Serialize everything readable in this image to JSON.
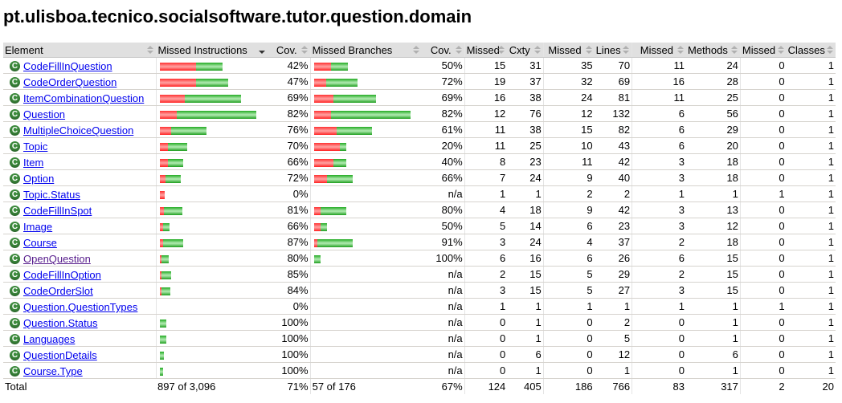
{
  "title": "pt.ulisboa.tecnico.socialsoftware.tutor.question.domain",
  "columns": [
    "Element",
    "Missed Instructions",
    "Cov.",
    "Missed Branches",
    "Cov.",
    "Missed",
    "Cxty",
    "Missed",
    "Lines",
    "Missed",
    "Methods",
    "Missed",
    "Classes"
  ],
  "sorted_column": "Missed Instructions",
  "colors": {
    "missed": "#ff3030",
    "covered": "#22aa22",
    "header_bg": "#e0e0e0",
    "link": "#0000ee",
    "visited_link": "#551a8b",
    "class_icon": "#3c8a3c"
  },
  "rows": [
    {
      "name": "CodeFillInQuestion",
      "visited": false,
      "instr_missed": 224,
      "instr_covered": 166,
      "instr_cov": "42%",
      "br_missed": 16,
      "br_covered": 16,
      "br_cov": "50%",
      "cxty_missed": "15",
      "cxty": "31",
      "lines_missed": "35",
      "lines": "70",
      "methods_missed": "11",
      "methods": "24",
      "classes_missed": "0",
      "classes": "1"
    },
    {
      "name": "CodeOrderQuestion",
      "visited": false,
      "instr_missed": 224,
      "instr_covered": 202,
      "instr_cov": "47%",
      "br_missed": 11,
      "br_covered": 29,
      "br_cov": "72%",
      "cxty_missed": "19",
      "cxty": "37",
      "lines_missed": "32",
      "lines": "69",
      "methods_missed": "16",
      "methods": "28",
      "classes_missed": "0",
      "classes": "1"
    },
    {
      "name": "ItemCombinationQuestion",
      "visited": false,
      "instr_missed": 156,
      "instr_covered": 352,
      "instr_cov": "69%",
      "br_missed": 18,
      "br_covered": 40,
      "br_cov": "69%",
      "cxty_missed": "16",
      "cxty": "38",
      "lines_missed": "24",
      "lines": "81",
      "methods_missed": "11",
      "methods": "25",
      "classes_missed": "0",
      "classes": "1"
    },
    {
      "name": "Question",
      "visited": false,
      "instr_missed": 106,
      "instr_covered": 494,
      "instr_cov": "82%",
      "br_missed": 16,
      "br_covered": 74,
      "br_cov": "82%",
      "cxty_missed": "12",
      "cxty": "76",
      "lines_missed": "12",
      "lines": "132",
      "methods_missed": "6",
      "methods": "56",
      "classes_missed": "0",
      "classes": "1"
    },
    {
      "name": "MultipleChoiceQuestion",
      "visited": false,
      "instr_missed": 70,
      "instr_covered": 218,
      "instr_cov": "76%",
      "br_missed": 21,
      "br_covered": 33,
      "br_cov": "61%",
      "cxty_missed": "11",
      "cxty": "38",
      "lines_missed": "15",
      "lines": "82",
      "methods_missed": "6",
      "methods": "29",
      "classes_missed": "0",
      "classes": "1"
    },
    {
      "name": "Topic",
      "visited": false,
      "instr_missed": 52,
      "instr_covered": 122,
      "instr_cov": "70%",
      "br_missed": 24,
      "br_covered": 6,
      "br_cov": "20%",
      "cxty_missed": "11",
      "cxty": "25",
      "lines_missed": "10",
      "lines": "43",
      "methods_missed": "6",
      "methods": "20",
      "classes_missed": "0",
      "classes": "1"
    },
    {
      "name": "Item",
      "visited": false,
      "instr_missed": 50,
      "instr_covered": 96,
      "instr_cov": "66%",
      "br_missed": 18,
      "br_covered": 12,
      "br_cov": "40%",
      "cxty_missed": "8",
      "cxty": "23",
      "lines_missed": "11",
      "lines": "42",
      "methods_missed": "3",
      "methods": "18",
      "classes_missed": "0",
      "classes": "1"
    },
    {
      "name": "Option",
      "visited": false,
      "instr_missed": 36,
      "instr_covered": 96,
      "instr_cov": "72%",
      "br_missed": 12,
      "br_covered": 24,
      "br_cov": "66%",
      "cxty_missed": "7",
      "cxty": "24",
      "lines_missed": "9",
      "lines": "40",
      "methods_missed": "3",
      "methods": "18",
      "classes_missed": "0",
      "classes": "1"
    },
    {
      "name": "Topic.Status",
      "visited": false,
      "instr_missed": 30,
      "instr_covered": 0,
      "instr_cov": "0%",
      "br_missed": 0,
      "br_covered": 0,
      "br_cov": "n/a",
      "cxty_missed": "1",
      "cxty": "1",
      "lines_missed": "2",
      "lines": "2",
      "methods_missed": "1",
      "methods": "1",
      "classes_missed": "1",
      "classes": "1"
    },
    {
      "name": "CodeFillInSpot",
      "visited": false,
      "instr_missed": 26,
      "instr_covered": 114,
      "instr_cov": "81%",
      "br_missed": 6,
      "br_covered": 24,
      "br_cov": "80%",
      "cxty_missed": "4",
      "cxty": "18",
      "lines_missed": "9",
      "lines": "42",
      "methods_missed": "3",
      "methods": "13",
      "classes_missed": "0",
      "classes": "1"
    },
    {
      "name": "Image",
      "visited": false,
      "instr_missed": 20,
      "instr_covered": 40,
      "instr_cov": "66%",
      "br_missed": 6,
      "br_covered": 6,
      "br_cov": "50%",
      "cxty_missed": "5",
      "cxty": "14",
      "lines_missed": "6",
      "lines": "23",
      "methods_missed": "3",
      "methods": "12",
      "classes_missed": "0",
      "classes": "1"
    },
    {
      "name": "Course",
      "visited": false,
      "instr_missed": 18,
      "instr_covered": 126,
      "instr_cov": "87%",
      "br_missed": 3,
      "br_covered": 33,
      "br_cov": "91%",
      "cxty_missed": "3",
      "cxty": "24",
      "lines_missed": "4",
      "lines": "37",
      "methods_missed": "2",
      "methods": "18",
      "classes_missed": "0",
      "classes": "1"
    },
    {
      "name": "OpenQuestion",
      "visited": true,
      "instr_missed": 12,
      "instr_covered": 46,
      "instr_cov": "80%",
      "br_missed": 0,
      "br_covered": 6,
      "br_cov": "100%",
      "cxty_missed": "6",
      "cxty": "16",
      "lines_missed": "6",
      "lines": "26",
      "methods_missed": "6",
      "methods": "15",
      "classes_missed": "0",
      "classes": "1"
    },
    {
      "name": "CodeFillInOption",
      "visited": false,
      "instr_missed": 10,
      "instr_covered": 60,
      "instr_cov": "85%",
      "br_missed": 0,
      "br_covered": 0,
      "br_cov": "n/a",
      "cxty_missed": "2",
      "cxty": "15",
      "lines_missed": "5",
      "lines": "29",
      "methods_missed": "2",
      "methods": "15",
      "classes_missed": "0",
      "classes": "1"
    },
    {
      "name": "CodeOrderSlot",
      "visited": false,
      "instr_missed": 10,
      "instr_covered": 54,
      "instr_cov": "84%",
      "br_missed": 0,
      "br_covered": 0,
      "br_cov": "n/a",
      "cxty_missed": "3",
      "cxty": "15",
      "lines_missed": "5",
      "lines": "27",
      "methods_missed": "3",
      "methods": "15",
      "classes_missed": "0",
      "classes": "1"
    },
    {
      "name": "Question.QuestionTypes",
      "visited": false,
      "instr_missed": 0,
      "instr_covered": 0,
      "instr_cov": "0%",
      "br_missed": 0,
      "br_covered": 0,
      "br_cov": "n/a",
      "cxty_missed": "1",
      "cxty": "1",
      "lines_missed": "1",
      "lines": "1",
      "methods_missed": "1",
      "methods": "1",
      "classes_missed": "1",
      "classes": "1"
    },
    {
      "name": "Question.Status",
      "visited": false,
      "instr_missed": 0,
      "instr_covered": 40,
      "instr_cov": "100%",
      "br_missed": 0,
      "br_covered": 0,
      "br_cov": "n/a",
      "cxty_missed": "0",
      "cxty": "1",
      "lines_missed": "0",
      "lines": "2",
      "methods_missed": "0",
      "methods": "1",
      "classes_missed": "0",
      "classes": "1"
    },
    {
      "name": "Languages",
      "visited": false,
      "instr_missed": 0,
      "instr_covered": 40,
      "instr_cov": "100%",
      "br_missed": 0,
      "br_covered": 0,
      "br_cov": "n/a",
      "cxty_missed": "0",
      "cxty": "1",
      "lines_missed": "0",
      "lines": "5",
      "methods_missed": "0",
      "methods": "1",
      "classes_missed": "0",
      "classes": "1"
    },
    {
      "name": "QuestionDetails",
      "visited": false,
      "instr_missed": 0,
      "instr_covered": 24,
      "instr_cov": "100%",
      "br_missed": 0,
      "br_covered": 0,
      "br_cov": "n/a",
      "cxty_missed": "0",
      "cxty": "6",
      "lines_missed": "0",
      "lines": "12",
      "methods_missed": "0",
      "methods": "6",
      "classes_missed": "0",
      "classes": "1"
    },
    {
      "name": "Course.Type",
      "visited": false,
      "instr_missed": 0,
      "instr_covered": 18,
      "instr_cov": "100%",
      "br_missed": 0,
      "br_covered": 0,
      "br_cov": "n/a",
      "cxty_missed": "0",
      "cxty": "1",
      "lines_missed": "0",
      "lines": "1",
      "methods_missed": "0",
      "methods": "1",
      "classes_missed": "0",
      "classes": "1"
    }
  ],
  "total": {
    "label": "Total",
    "instr": "897 of 3,096",
    "instr_cov": "71%",
    "br": "57 of 176",
    "br_cov": "67%",
    "cxty_missed": "124",
    "cxty": "405",
    "lines_missed": "186",
    "lines": "766",
    "methods_missed": "83",
    "methods": "317",
    "classes_missed": "2",
    "classes": "20"
  }
}
